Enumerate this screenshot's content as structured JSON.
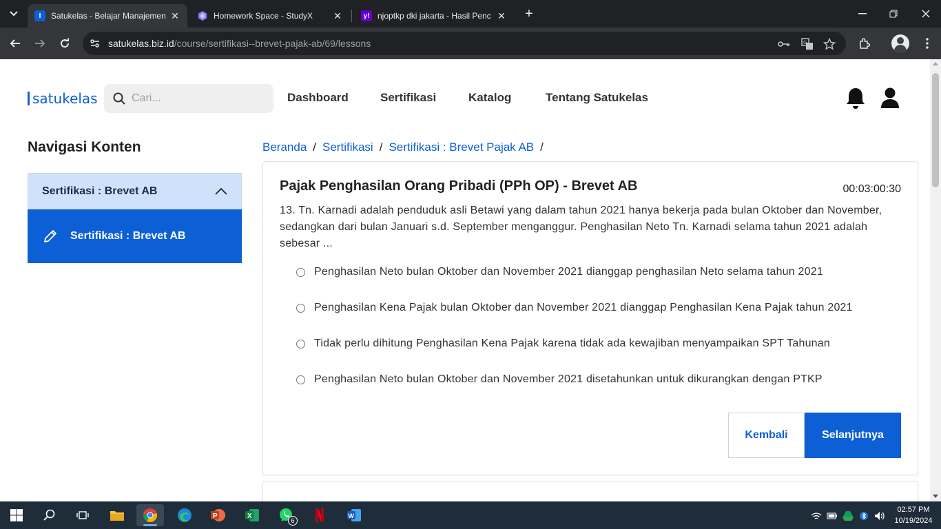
{
  "browser": {
    "tabs": [
      {
        "title": "Satukelas - Belajar Manajemen",
        "favicon": "satukelas-logo-icon",
        "active": true
      },
      {
        "title": "Homework Space - StudyX",
        "favicon": "studyx-icon",
        "active": false
      },
      {
        "title": "njoptkp dki jakarta - Hasil Penc",
        "favicon": "yahoo-icon",
        "active": false
      }
    ],
    "new_tab": "+",
    "url_host": "satukelas.biz.id",
    "url_path": "/course/sertifikasi--brevet-pajak-ab/69/lessons"
  },
  "site": {
    "logo": "satukelas",
    "search_placeholder": "Cari...",
    "nav": [
      "Dashboard",
      "Sertifikasi",
      "Katalog",
      "Tentang Satukelas"
    ],
    "accent_color": "#0d5fd6"
  },
  "sidebar": {
    "title": "Navigasi Konten",
    "section": "Sertifikasi : Brevet AB",
    "item": "Sertifikasi : Brevet AB"
  },
  "breadcrumb": [
    "Beranda",
    "Sertifikasi",
    "Sertifikasi : Brevet Pajak AB"
  ],
  "quiz": {
    "title": "Pajak Penghasilan Orang Pribadi (PPh OP) - Brevet AB",
    "timer": "00:03:00:30",
    "question": "13. Tn. Karnadi adalah penduduk asli Betawi yang dalam tahun 2021 hanya bekerja pada bulan Oktober dan November, sedangkan dari bulan Januari s.d. September menganggur. Penghasilan Neto Tn. Karnadi selama tahun 2021 adalah sebesar ...",
    "options": [
      "Penghasilan Neto bulan Oktober dan November 2021 dianggap penghasilan Neto selama tahun 2021",
      "Penghasilan Kena Pajak bulan Oktober dan November 2021 dianggap Penghasilan Kena Pajak tahun 2021",
      "Tidak perlu dihitung Penghasilan Kena Pajak karena tidak ada kewajiban menyampaikan SPT Tahunan",
      "Penghasilan Neto bulan Oktober dan November 2021 disetahunkan untuk dikurangkan dengan PTKP"
    ],
    "back_label": "Kembali",
    "next_label": "Selanjutnya"
  },
  "taskbar": {
    "apps": [
      "windows-start-icon",
      "search-icon",
      "task-view-icon",
      "file-explorer-icon",
      "chrome-icon",
      "edge-icon",
      "powerpoint-icon",
      "excel-icon",
      "whatsapp-icon",
      "netflix-icon",
      "word-icon"
    ],
    "whatsapp_badge": "6",
    "time": "02:57 PM",
    "date": "10/19/2024"
  }
}
